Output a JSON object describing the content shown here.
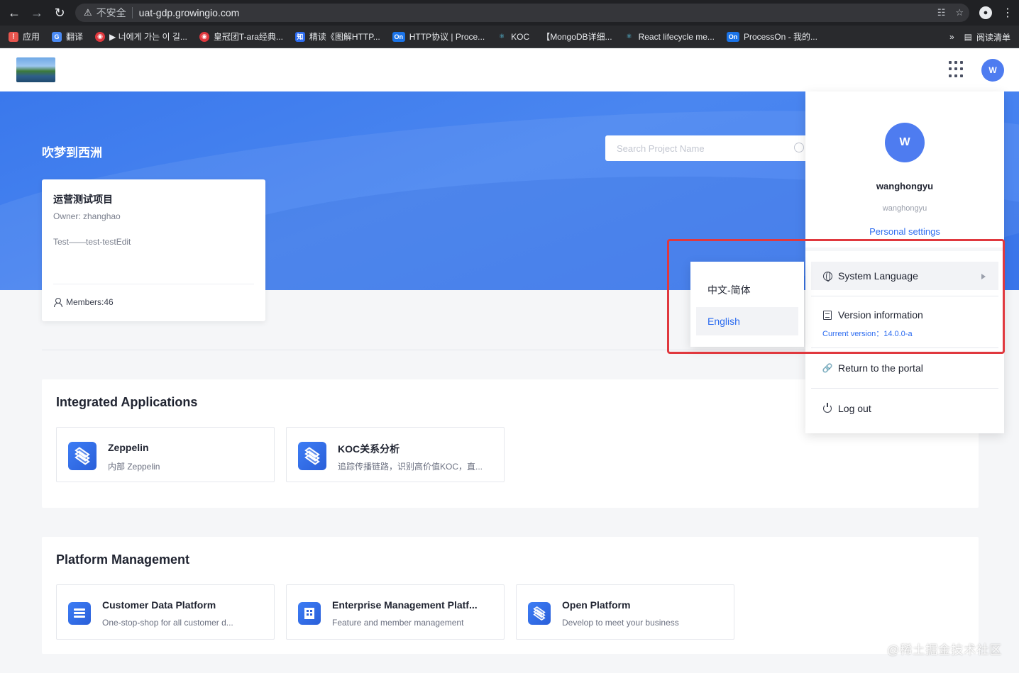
{
  "browser": {
    "insecure_label": "不安全",
    "url": "uat-gdp.growingio.com",
    "bookmarks": [
      {
        "label": "应用",
        "color": "#e8554e"
      },
      {
        "label": "翻译",
        "color": "#4a8af4"
      },
      {
        "label": "▶ 너에게 가는 이 길...",
        "color": "#e0383e"
      },
      {
        "label": "皇冠团T-ara经典...",
        "color": "#e0383e"
      },
      {
        "label": "精读《图解HTTP...",
        "color": "#2d6cf0"
      },
      {
        "label": "HTTP协议 | Proce...",
        "color": "#1a73e8"
      },
      {
        "label": "KOC",
        "color": "#61dafb"
      },
      {
        "label": "【MongoDB详细...",
        "color": "#292a2d"
      },
      {
        "label": "React lifecycle me...",
        "color": "#61dafb"
      },
      {
        "label": "ProcessOn - 我的...",
        "color": "#1a73e8"
      }
    ],
    "more_label": "»",
    "reading_list_label": "阅读清单"
  },
  "header": {
    "avatar_initial": "W"
  },
  "banner": {
    "org_title": "吹梦到西洲",
    "search_placeholder": "Search Project Name"
  },
  "project": {
    "name": "运营测试项目",
    "owner": "Owner: zhanghao",
    "description": "Test——test-testEdit",
    "members": "Members:46"
  },
  "integrated": {
    "title": "Integrated Applications",
    "apps": [
      {
        "name": "Zeppelin",
        "desc": "内部 Zeppelin"
      },
      {
        "name": "KOC关系分析",
        "desc": "追踪传播链路，识别高价值KOC，直..."
      }
    ]
  },
  "platform": {
    "title": "Platform Management",
    "apps": [
      {
        "name": "Customer Data Platform",
        "desc": "One-stop-shop for all customer d..."
      },
      {
        "name": "Enterprise Management Platf...",
        "desc": "Feature and member management"
      },
      {
        "name": "Open Platform",
        "desc": "Develop to meet your business"
      }
    ]
  },
  "user_panel": {
    "avatar_initial": "W",
    "username": "wanghongyu",
    "account": "wanghongyu",
    "personal_settings": "Personal settings",
    "system_language": "System Language",
    "version_information": "Version information",
    "current_version": "Current version：14.0.0-a",
    "return_portal": "Return to the portal",
    "log_out": "Log out"
  },
  "language_menu": {
    "options": [
      "中文-简体",
      "English"
    ],
    "selected": "English"
  },
  "watermark": "@稀土掘金技术社区",
  "colors": {
    "accent": "#2d6cf0",
    "banner": "#3f7bf0",
    "highlight": "#e0383e"
  }
}
